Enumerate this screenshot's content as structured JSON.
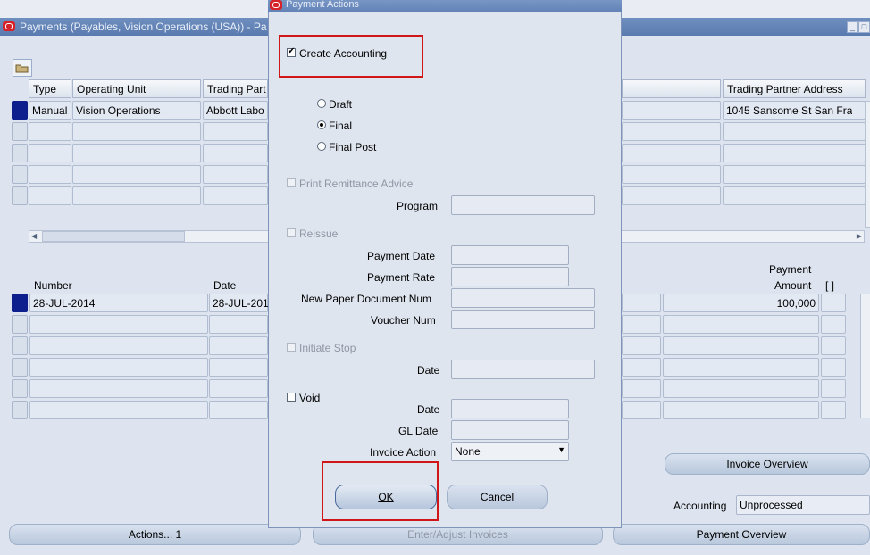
{
  "back_window": {
    "title": "Payments (Payables, Vision Operations (USA)) - Pa",
    "table": {
      "headers": [
        "Type",
        "Operating Unit",
        "Trading Part",
        "Trading Partner Address"
      ],
      "row1": [
        "Manual",
        "Vision Operations",
        "Abbott Labo",
        "1045 Sansome St  San Fra"
      ]
    },
    "lines": {
      "headers": {
        "number": "Number",
        "date": "Date",
        "payment": "Payment",
        "amount": "Amount",
        "bracket": "[ ]"
      },
      "row1": {
        "number": "28-JUL-2014",
        "date": "28-JUL-201",
        "amount": "100,000"
      }
    },
    "invoice_overview": "Invoice Overview",
    "accounting_label": "Accounting",
    "accounting_value": "Unprocessed",
    "buttons": {
      "actions": "Actions... 1",
      "enter_adjust": "Enter/Adjust Invoices",
      "payment_overview": "Payment Overview"
    }
  },
  "dialog": {
    "title": "Payment Actions",
    "create_accounting": "Create Accounting",
    "create_accounting_checked": true,
    "radio": {
      "draft": "Draft",
      "final": "Final",
      "final_post": "Final Post",
      "selected": "Final"
    },
    "print_remittance": "Print Remittance Advice",
    "program_label": "Program",
    "reissue": "Reissue",
    "payment_date": "Payment Date",
    "payment_rate": "Payment Rate",
    "new_paper_doc": "New Paper Document Num",
    "voucher_num": "Voucher Num",
    "initiate_stop": "Initiate Stop",
    "stop_date": "Date",
    "void": "Void",
    "void_date": "Date",
    "gl_date": "GL Date",
    "invoice_action_label": "Invoice Action",
    "invoice_action_value": "None",
    "ok": "OK",
    "cancel": "Cancel"
  },
  "colors": {
    "selected_row": "#0c1f8c",
    "highlight_box": "#d01616"
  }
}
